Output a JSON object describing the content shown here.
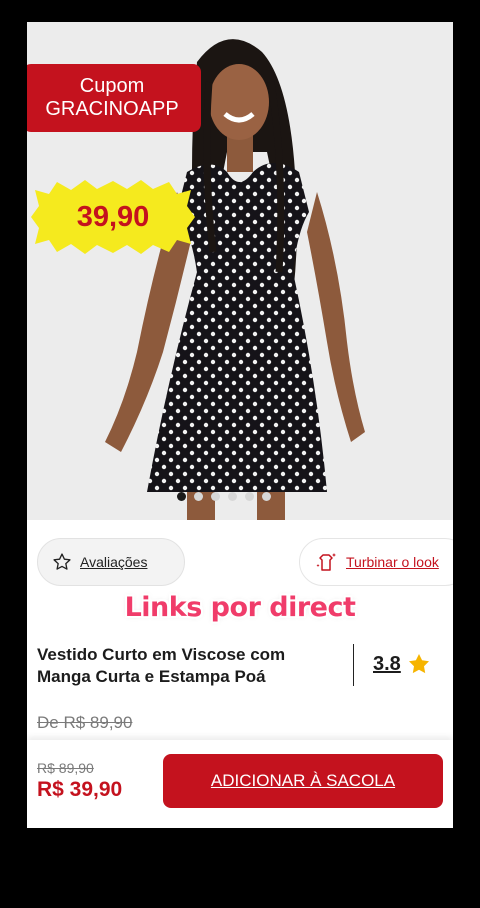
{
  "coupon": {
    "line1": "Cupom",
    "line2": "GRACINOAPP"
  },
  "badge": {
    "price": "39,90"
  },
  "carousel": {
    "total": 6,
    "active_index": 0
  },
  "actions": {
    "reviews_label": "Avaliações",
    "look_label": "Turbinar o look"
  },
  "promo_text": "Links por direct",
  "product": {
    "title": "Vestido Curto em Viscose com Manga Curta e Estampa Poá",
    "rating": "3.8",
    "old_price": "De R$ 89,90"
  },
  "footer": {
    "old_price": "R$ 89,90",
    "price": "R$ 39,90",
    "add_button": "ADICIONAR À SACOLA"
  },
  "colors": {
    "brand_red": "#c4121e",
    "promo_pink": "#f03c6a",
    "star": "#f6b400"
  },
  "icons": [
    "star-outline-icon",
    "hanger-sparkle-icon",
    "star-filled-icon"
  ]
}
